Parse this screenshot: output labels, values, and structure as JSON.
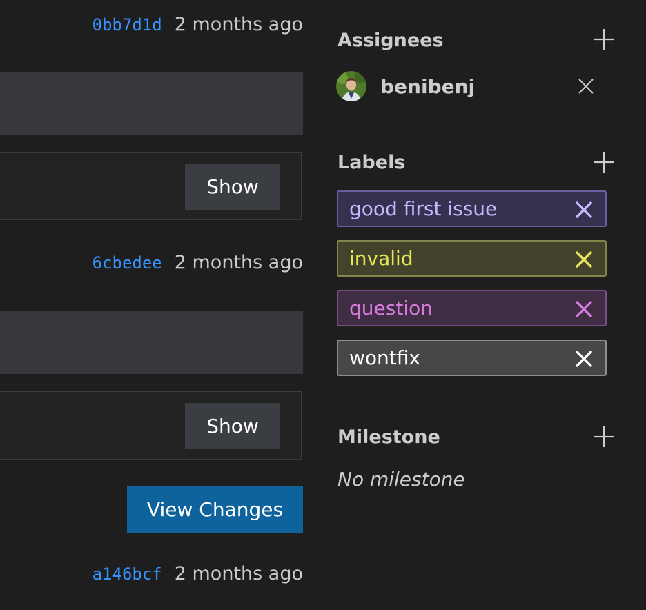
{
  "timeline": {
    "commits": [
      {
        "sha": "0bb7d1d",
        "time": "2 months ago"
      },
      {
        "sha": "6cbedee",
        "time": "2 months ago"
      },
      {
        "sha": "a146bcf",
        "time": "2 months ago"
      }
    ],
    "show_label": "Show",
    "view_changes_label": "View Changes"
  },
  "sidebar": {
    "assignees": {
      "title": "Assignees",
      "items": [
        {
          "name": "benibenj"
        }
      ]
    },
    "labels": {
      "title": "Labels",
      "items": [
        {
          "name": "good first issue",
          "color": "#c5b8ff",
          "bg": "#35314f",
          "border": "#6a5f9e"
        },
        {
          "name": "invalid",
          "color": "#e6e65a",
          "bg": "#43432c",
          "border": "#85854a"
        },
        {
          "name": "question",
          "color": "#d77ae0",
          "bg": "#3f2d43",
          "border": "#7b4d86"
        },
        {
          "name": "wontfix",
          "color": "#ffffff",
          "bg": "#474747",
          "border": "#8e8e8e"
        }
      ]
    },
    "milestone": {
      "title": "Milestone",
      "value": "No milestone"
    }
  },
  "colors": {
    "background": "#1e1e1e",
    "link": "#3794ff",
    "primary_button": "#0e639c",
    "secondary_button": "#3a3d41"
  }
}
